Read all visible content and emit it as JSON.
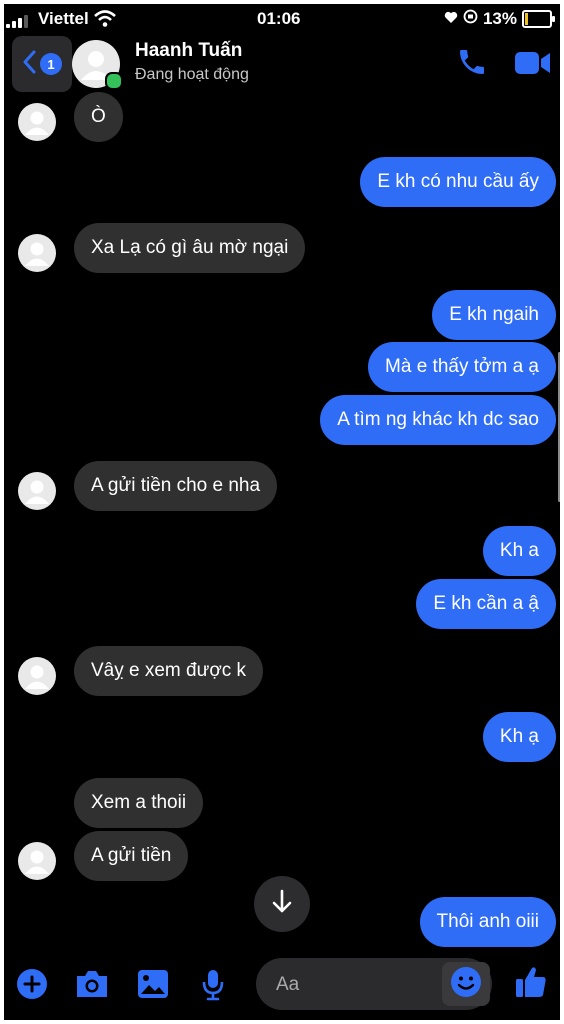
{
  "status_bar": {
    "carrier": "Viettel",
    "time": "01:06",
    "battery": "13%",
    "battery_level": 0.13
  },
  "header": {
    "unread_count": "1",
    "contact_name": "Haanh Tuấn",
    "contact_status": "Đang hoạt động"
  },
  "messages": [
    {
      "side": "received",
      "text": "Ò"
    },
    {
      "side": "sent",
      "text": "E kh có nhu cầu ấy"
    },
    {
      "side": "received",
      "text": "Xa Lạ có gì âu mờ ngại"
    },
    {
      "side": "sent",
      "text": "E kh ngaih"
    },
    {
      "side": "sent",
      "text": "Mà e thấy tởm a ạ"
    },
    {
      "side": "sent",
      "text": "A tìm ng khác kh dc sao"
    },
    {
      "side": "received",
      "text": "A gửi tiền cho e nha"
    },
    {
      "side": "sent",
      "text": "Kh a"
    },
    {
      "side": "sent",
      "text": "E kh cần a ậ"
    },
    {
      "side": "received",
      "text": "Vâỵ e xem được k"
    },
    {
      "side": "sent",
      "text": "Kh ạ"
    },
    {
      "side": "received",
      "text": "Xem a thoii"
    },
    {
      "side": "received",
      "text": "A gửi tiền"
    },
    {
      "side": "sent",
      "text": "Thôi anh oiii"
    }
  ],
  "composer": {
    "placeholder": "Aa"
  },
  "icons": {
    "back": "chevron-left-icon",
    "call": "phone-icon",
    "video": "video-camera-icon",
    "add": "plus-icon",
    "camera": "camera-icon",
    "gallery": "image-icon",
    "voice": "microphone-icon",
    "emoji": "smiley-icon",
    "like": "thumbs-up-icon",
    "scroll": "arrow-down-icon"
  },
  "colors": {
    "sent_bubble": "#2f6df6",
    "received_bubble": "#303031",
    "accent": "#2f6df6",
    "online": "#35c15a",
    "battery_charging": "#f2c01f"
  }
}
